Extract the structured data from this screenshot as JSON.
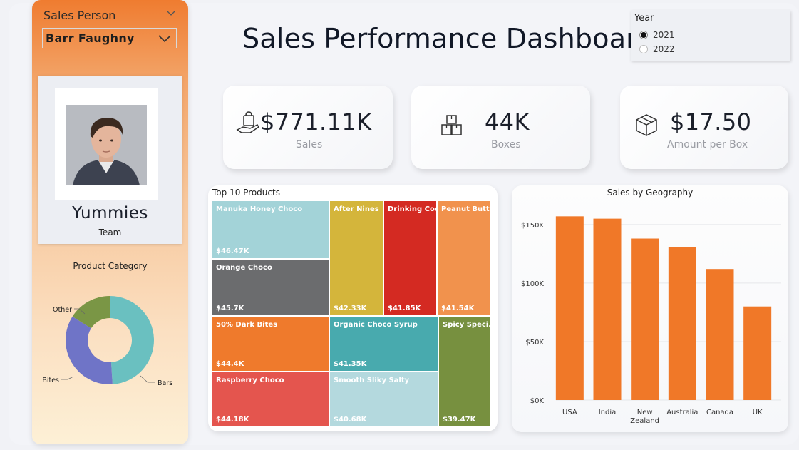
{
  "colors": {
    "accent_orange": "#ef7c30",
    "bar_orange": "#f07828"
  },
  "sidebar": {
    "slicer_title": "Sales Person",
    "selected_person": "Barr Faughny",
    "team_name": "Yummies",
    "team_label": "Team",
    "category_title": "Product Category",
    "donut": {
      "slices": [
        {
          "label": "Bars",
          "value": 49,
          "color": "#6ac0c0"
        },
        {
          "label": "Bites",
          "value": 35,
          "color": "#6f74c7"
        },
        {
          "label": "Other",
          "value": 16,
          "color": "#7a9645"
        }
      ]
    }
  },
  "header": {
    "title": "Sales Performance Dashboard"
  },
  "year_slicer": {
    "title": "Year",
    "options": [
      {
        "label": "2021",
        "selected": true
      },
      {
        "label": "2022",
        "selected": false
      }
    ]
  },
  "kpis": {
    "sales": {
      "value": "$771.11K",
      "label": "Sales",
      "icon": "shopping-hand-icon"
    },
    "boxes": {
      "value": "44K",
      "label": "Boxes",
      "icon": "boxes-icon"
    },
    "amount_per_box": {
      "value": "$17.50",
      "label": "Amount per Box",
      "icon": "package-icon"
    }
  },
  "treemap": {
    "title": "Top 10 Products",
    "tiles": [
      {
        "name": "Manuka Honey Choco",
        "value": "$46.47K",
        "color": "#a3d3d8"
      },
      {
        "name": "Orange Choco",
        "value": "$45.7K",
        "color": "#6b6c6e"
      },
      {
        "name": "After Nines",
        "value": "$42.33K",
        "color": "#d4b53b"
      },
      {
        "name": "Drinking Coco",
        "value": "$41.85K",
        "color": "#d42a22"
      },
      {
        "name": "Peanut Butt...",
        "value": "$41.54K",
        "color": "#f1924d"
      },
      {
        "name": "50% Dark Bites",
        "value": "$44.4K",
        "color": "#ef7a2c"
      },
      {
        "name": "Organic Choco Syrup",
        "value": "$41.35K",
        "color": "#48aaae"
      },
      {
        "name": "Spicy Speci...",
        "value": "$39.47K",
        "color": "#77903f"
      },
      {
        "name": "Raspberry Choco",
        "value": "$44.18K",
        "color": "#e4554e"
      },
      {
        "name": "Smooth Sliky Salty",
        "value": "$40.68K",
        "color": "#b4d9de"
      }
    ]
  },
  "chart_data": {
    "type": "bar",
    "title": "Sales by Geography",
    "categories": [
      "USA",
      "India",
      "New Zealand",
      "Australia",
      "Canada",
      "UK"
    ],
    "values": [
      157,
      155,
      138,
      131,
      112,
      80
    ],
    "value_unit": "K",
    "yticks": [
      "$0K",
      "$50K",
      "$100K",
      "$150K"
    ],
    "ylim": [
      0,
      170
    ],
    "grid": true,
    "color": "#f07828"
  }
}
